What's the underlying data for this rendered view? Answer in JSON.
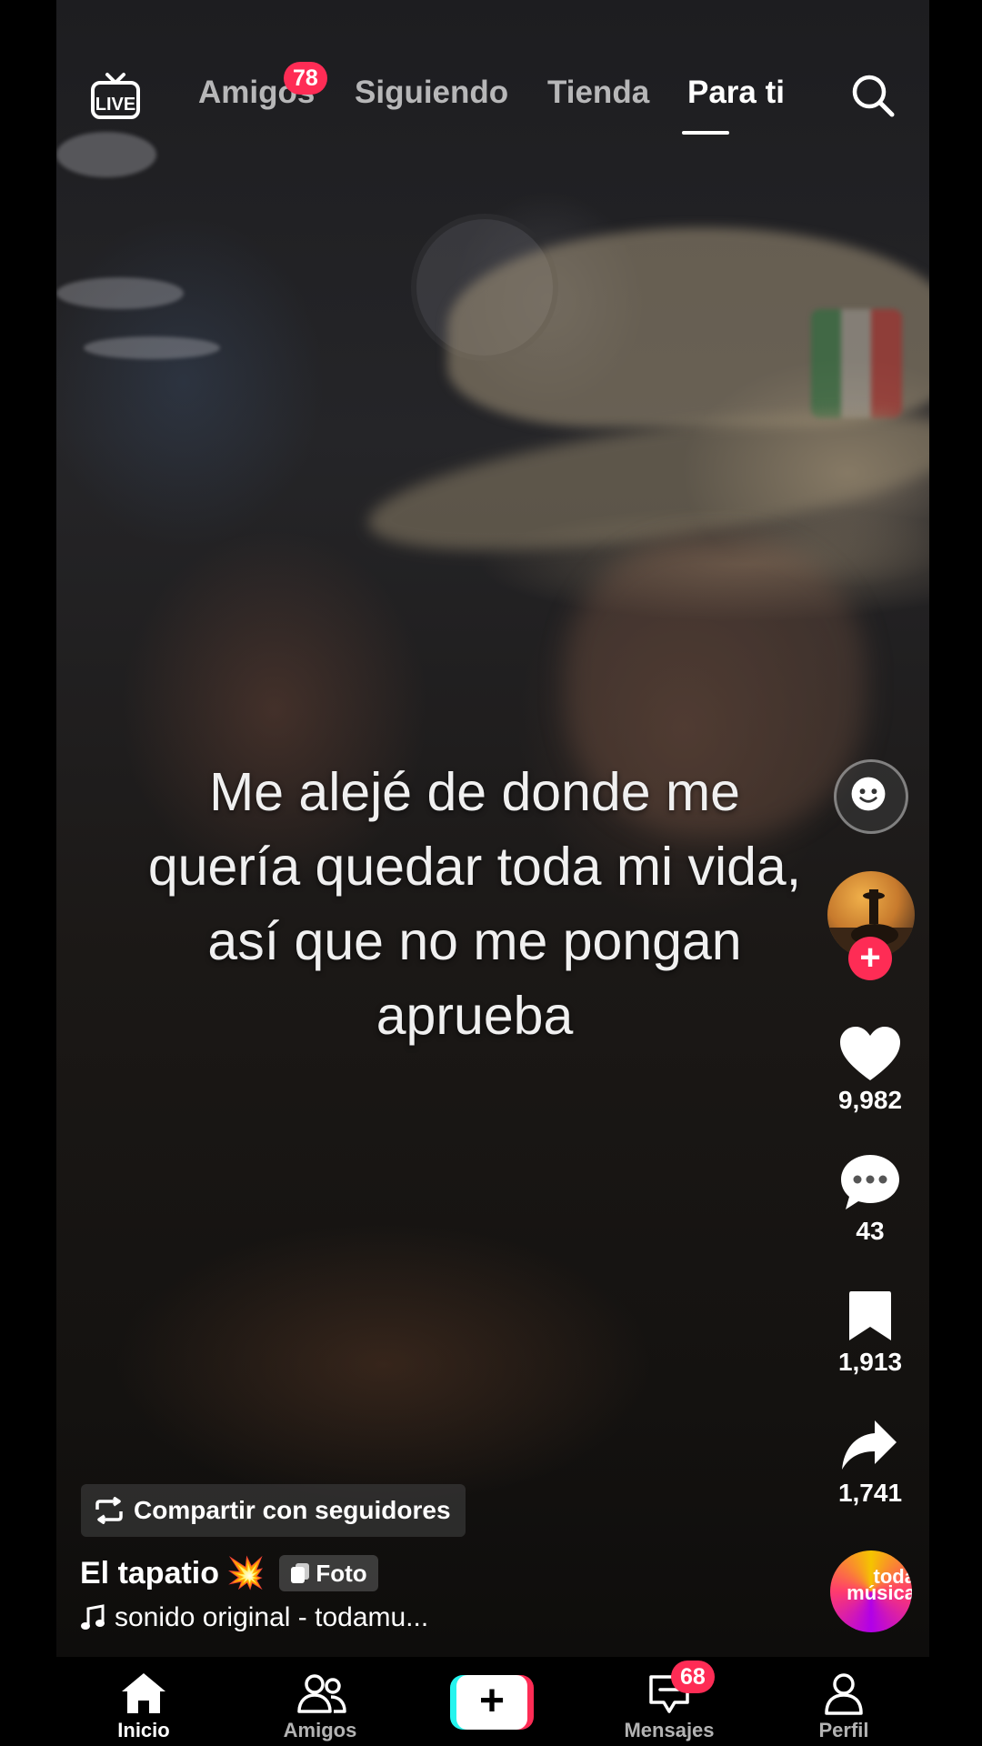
{
  "topbar": {
    "tabs": [
      {
        "label": "Amigos",
        "badge": "78"
      },
      {
        "label": "Siguiendo"
      },
      {
        "label": "Tienda"
      },
      {
        "label": "Para ti",
        "active": true
      }
    ],
    "live_icon": "live-tv-icon",
    "search_icon": "search-icon"
  },
  "caption": {
    "line1": "Me alejé de donde me",
    "line2": "quería quedar toda mi vida,",
    "line3": "así que no me pongan",
    "line4": "aprueba"
  },
  "rail": {
    "likes": "9,982",
    "comments": "43",
    "saves": "1,913",
    "shares": "1,741",
    "follow_symbol": "+",
    "disc_text": "toda música"
  },
  "post": {
    "share_label": "Compartir con seguidores",
    "author": "El tapatio",
    "author_emoji": "💥",
    "tag": "Foto",
    "sound": "sonido original - todamu..."
  },
  "nav": {
    "items": [
      {
        "label": "Inicio",
        "active": true
      },
      {
        "label": "Amigos"
      },
      {
        "label": "Mensajes",
        "badge": "68"
      },
      {
        "label": "Perfil"
      }
    ],
    "create_symbol": "+"
  },
  "colors": {
    "accent": "#fe2c55",
    "create_cyan": "#25f4ee"
  }
}
